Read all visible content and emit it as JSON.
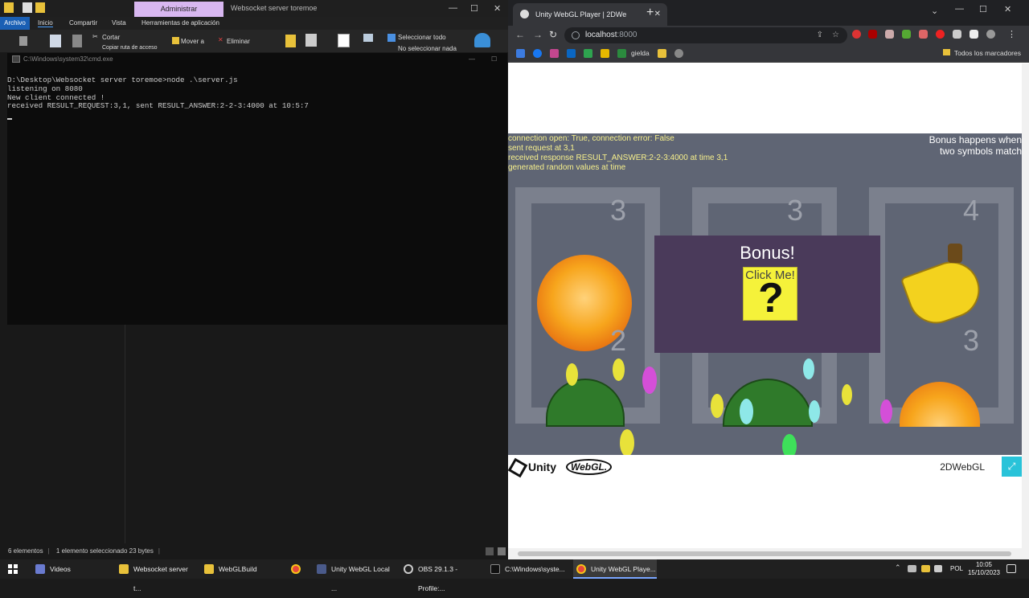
{
  "explorer": {
    "ctx_tab": "Administrar",
    "window_title": "Websocket server toremoe",
    "tabs": [
      "Archivo",
      "Inicio",
      "Compartir",
      "Vista",
      "Herramientas de aplicación"
    ],
    "ribbon": {
      "cut": "Cortar",
      "copy_path": "Copiar ruta de acceso",
      "move_to": "Mover a",
      "delete": "Eliminar",
      "select_all": "Seleccionar todo",
      "select_none": "No seleccionar nada"
    },
    "status": {
      "items": "6 elementos",
      "selected": "1 elemento seleccionado 23 bytes"
    }
  },
  "cmd": {
    "title": "C:\\Windows\\system32\\cmd.exe",
    "lines": [
      "D:\\Desktop\\Websocket server toremoe>node .\\server.js",
      "listening on 8080",
      "New client connected !",
      "received RESULT_REQUEST:3,1, sent RESULT_ANSWER:2-2-3:4000 at 10:5:7"
    ]
  },
  "browser": {
    "tab_title": "Unity WebGL Player | 2DWe",
    "url_host": "localhost",
    "url_port": ":8000",
    "bookmarks": {
      "gielda": "gielda",
      "all": "Todos los marcadores"
    }
  },
  "game": {
    "status_lines": [
      "connection open: True, connection error: False",
      "sent request at 3,1",
      "received response RESULT_ANSWER:2-2-3:4000 at time 3,1",
      "generated random values  at time"
    ],
    "bonus_hint_1": "Bonus happens when",
    "bonus_hint_2": "two symbols match",
    "reel_numbers": [
      "3",
      "2",
      "3",
      "4",
      "3"
    ],
    "bonus_title": "Bonus!",
    "bonus_button": "Click Me!",
    "bonus_glyph": "?",
    "footer_unity": "Unity",
    "footer_webgl": "WebGL.",
    "build_title": "2DWebGL"
  },
  "taskbar": {
    "items": [
      "Videos",
      "Websocket server t...",
      "WebGLBuild",
      "",
      "Unity WebGL Local ...",
      "OBS 29.1.3 - Profile:...",
      "C:\\Windows\\syste...",
      "Unity WebGL Playe..."
    ],
    "lang": "POL",
    "time": "10:05",
    "date": "15/10/2023"
  },
  "colors": {
    "canvas_bg": "#5f6574",
    "status_text": "#f7f08c",
    "bonus_panel": "#4a3a5a",
    "bonus_button": "#f5f23a",
    "fullscreen": "#29c3d9"
  }
}
